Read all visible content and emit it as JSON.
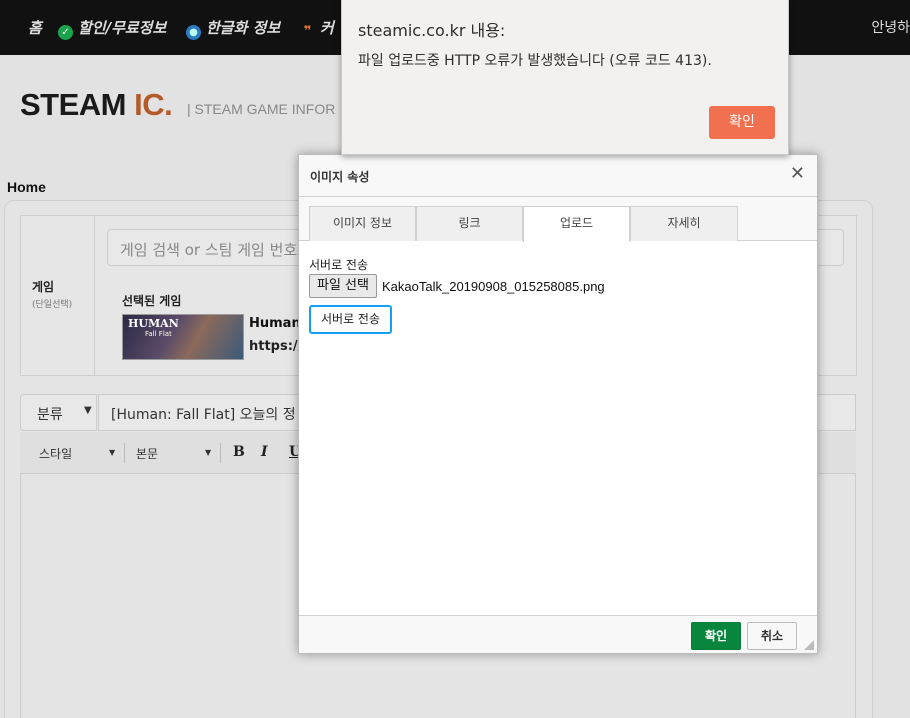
{
  "nav": {
    "items": [
      {
        "label": "홈",
        "icon": "home"
      },
      {
        "label": "할인/무료정보",
        "icon": "check-circle-icon"
      },
      {
        "label": "한글화 정보",
        "icon": "globe-icon"
      },
      {
        "label": "커",
        "icon": "chat-bubbles-icon"
      }
    ],
    "right_text": "안녕하"
  },
  "logo": {
    "main": "STEAM ",
    "accent": "IC.",
    "subtitle": "| STEAM GAME INFOR"
  },
  "breadcrumb": "Home",
  "game": {
    "label": "게임",
    "sublabel": "(단일선택)",
    "search_placeholder": "게임 검색 or 스팀 게임 번호",
    "selected_label": "선택된 게임",
    "thumb_title": "HUMAN",
    "thumb_sub": "Fall Flat",
    "name": "Human",
    "url": "https://"
  },
  "post": {
    "category": "분류",
    "title": "[Human: Fall Flat] 오늘의 정"
  },
  "toolbar": {
    "style": "스타일",
    "format": "본문",
    "bold": "B",
    "italic": "I",
    "underline": "U"
  },
  "dialog": {
    "title": "이미지 속성",
    "tabs": [
      "이미지 정보",
      "링크",
      "업로드",
      "자세히"
    ],
    "active_tab": "업로드",
    "upload_label": "서버로 전송",
    "file_button": "파일 선택",
    "file_name": "KakaoTalk_20190908_015258085.png",
    "send_button": "서버로 전송",
    "ok": "확인",
    "cancel": "취소"
  },
  "alert": {
    "title": "steamic.co.kr 내용:",
    "message": "파일 업로드중 HTTP 오류가 발생했습니다 (오류 코드 413).",
    "ok": "확인"
  },
  "colors": {
    "alert_ok": "#f07050",
    "dialog_ok": "#09863e",
    "focus_ring": "#139ff7",
    "logo_accent": "#b45a2a"
  }
}
